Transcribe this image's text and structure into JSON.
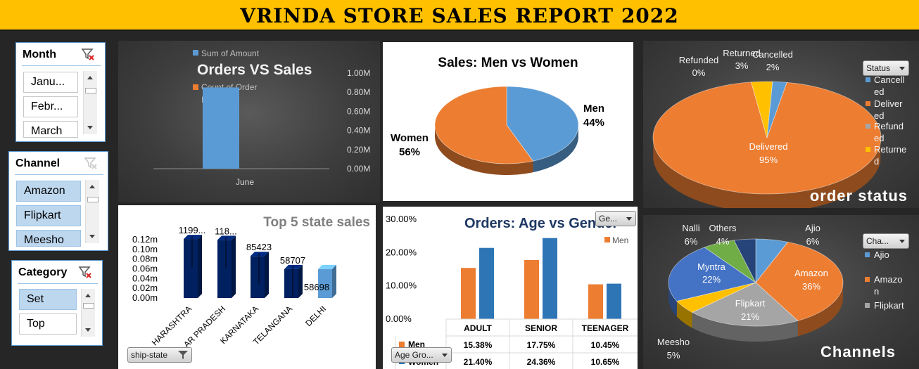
{
  "header": {
    "title": "VRINDA STORE SALES REPORT 2022"
  },
  "slicers": {
    "month": {
      "title": "Month",
      "items": [
        "Janu...",
        "Febr...",
        "March"
      ]
    },
    "channel": {
      "title": "Channel",
      "items": [
        "Amazon",
        "Flipkart",
        "Meesho"
      ]
    },
    "category": {
      "title": "Category",
      "items": [
        "Set",
        "Top"
      ]
    }
  },
  "orders_vs_sales": {
    "chart_data": {
      "type": "bar",
      "title": "Orders VS Sales",
      "legend": [
        "Sum of Amount",
        "Count of Order ID"
      ],
      "categories": [
        "June"
      ],
      "y_ticks": [
        "1.00M",
        "0.80M",
        "0.60M",
        "0.40M",
        "0.20M",
        "0.00M"
      ],
      "series": [
        {
          "name": "Sum of Amount",
          "values": [
            0.85
          ]
        }
      ],
      "ylim": [
        0,
        1.0
      ],
      "unit": "M"
    }
  },
  "men_vs_women": {
    "chart_data": {
      "type": "pie",
      "title": "Sales: Men vs Women",
      "labels": [
        "Men",
        "Women"
      ],
      "values": [
        44,
        56
      ],
      "value_labels": [
        "44%",
        "56%"
      ],
      "colors": [
        "#5B9BD5",
        "#ED7D31"
      ]
    }
  },
  "order_status": {
    "title": "order status",
    "filter_label": "Status",
    "legend": [
      "Cancell ed",
      "Deliver ed",
      "Refund ed",
      "Returne d"
    ],
    "chart_data": {
      "type": "pie",
      "labels": [
        "Delivered",
        "Returned",
        "Cancelled",
        "Refunded"
      ],
      "values": [
        95,
        3,
        2,
        0
      ],
      "value_labels": [
        "95%",
        "3%",
        "2%",
        "0%"
      ],
      "colors": [
        "#ED7D31",
        "#FFC000",
        "#5B9BD5",
        "#A5A5A5"
      ]
    }
  },
  "top_states": {
    "filter_label": "ship-state",
    "chart_data": {
      "type": "bar",
      "title": "Top 5 state sales",
      "categories": [
        "HARASHTRA",
        "AR PRADESH",
        "KARNATAKA",
        "TELANGANA",
        "DELHI"
      ],
      "values": [
        119900,
        118000,
        85423,
        58707,
        58698
      ],
      "data_labels": [
        "1199...",
        "118...",
        "85423",
        "58707",
        "58698"
      ],
      "y_ticks": [
        "0.12m",
        "0.10m",
        "0.08m",
        "0.06m",
        "0.04m",
        "0.02m",
        "0.00m"
      ],
      "ylim": [
        0,
        0.12
      ]
    }
  },
  "age_gender": {
    "filter_label": "Ge...",
    "row_filter_label": "Age Gro...",
    "legend": [
      "Men"
    ],
    "chart_data": {
      "type": "bar",
      "title": "Orders: Age vs Gender",
      "categories": [
        "ADULT",
        "SENIOR",
        "TEENAGER"
      ],
      "series": [
        {
          "name": "Men",
          "values": [
            15.38,
            17.75,
            10.45
          ],
          "labels": [
            "15.38%",
            "17.75%",
            "10.45%"
          ]
        },
        {
          "name": "Women",
          "values": [
            21.4,
            24.36,
            10.65
          ],
          "labels": [
            "21.40%",
            "24.36%",
            "10.65%"
          ]
        }
      ],
      "y_ticks": [
        "30.00%",
        "20.00%",
        "10.00%",
        "0.00%"
      ],
      "ylim": [
        0,
        30
      ]
    }
  },
  "channels": {
    "title": "Channels",
    "filter_label": "Cha...",
    "legend": [
      "Ajio",
      "Amazo n",
      "Flipkart"
    ],
    "chart_data": {
      "type": "pie",
      "labels": [
        "Ajio",
        "Amazon",
        "Flipkart",
        "Meesho",
        "Myntra",
        "Nalli",
        "Others"
      ],
      "values": [
        6,
        36,
        21,
        5,
        22,
        6,
        4
      ],
      "value_labels": [
        "6%",
        "36%",
        "21%",
        "5%",
        "22%",
        "6%",
        "4%"
      ],
      "colors": [
        "#5B9BD5",
        "#ED7D31",
        "#A5A5A5",
        "#FFC000",
        "#4472C4",
        "#70AD47",
        "#264478"
      ]
    }
  }
}
